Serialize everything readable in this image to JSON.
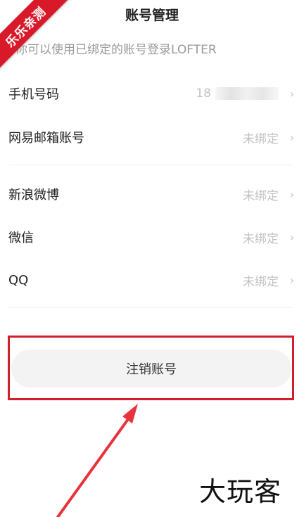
{
  "badge": {
    "text": "乐乐亲测"
  },
  "header": {
    "title": "账号管理"
  },
  "subtitle": "你可以使用已绑定的账号登录LOFTER",
  "rows": [
    {
      "label": "手机号码",
      "value": "18"
    },
    {
      "label": "网易邮箱账号",
      "value": "未绑定"
    },
    {
      "label": "新浪微博",
      "value": "未绑定"
    },
    {
      "label": "微信",
      "value": "未绑定"
    },
    {
      "label": "QQ",
      "value": "未绑定"
    }
  ],
  "chevron": "›",
  "cancel_button": {
    "label": "注销账号"
  },
  "watermark": {
    "text": "大玩客"
  },
  "colors": {
    "accent": "#d11f2b",
    "muted": "#c2c2c2"
  }
}
